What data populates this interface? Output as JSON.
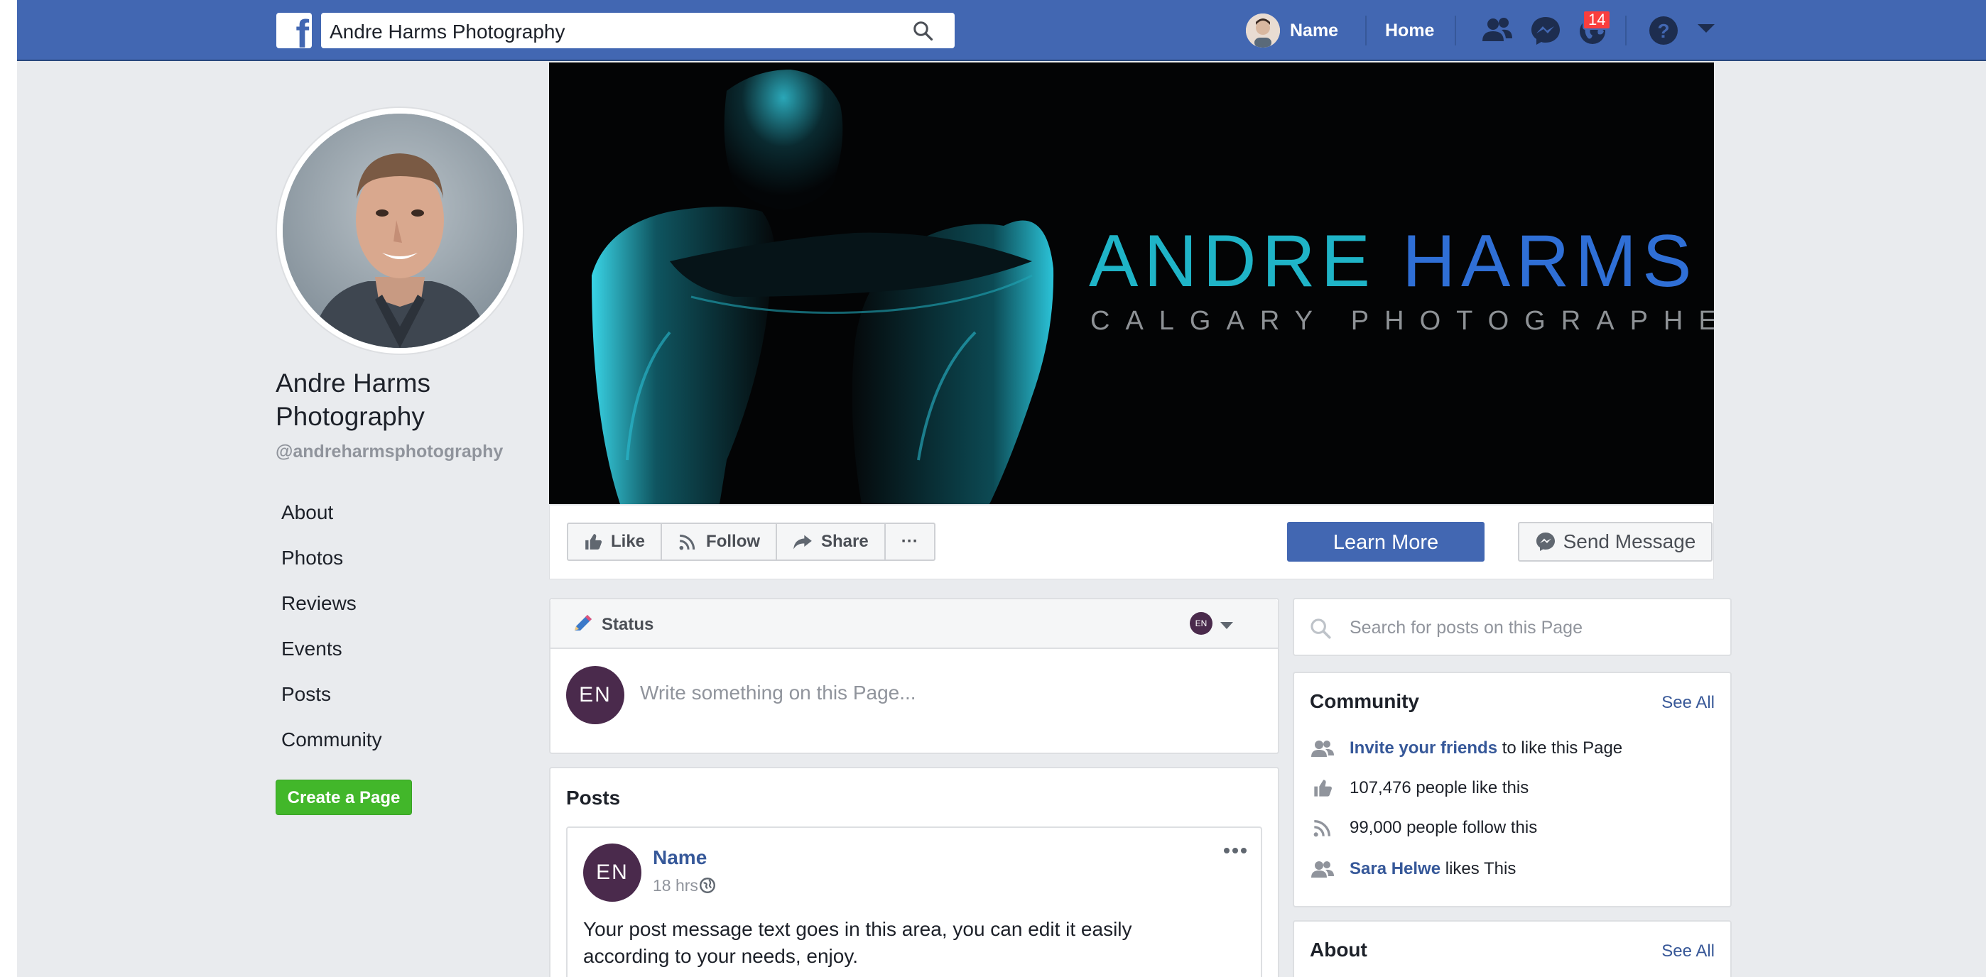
{
  "topbar": {
    "logo_letter": "f",
    "search_value": "Andre Harms Photography",
    "user_name": "Name",
    "home_label": "Home",
    "notifications_count": "14",
    "brand_color": "#4267b2"
  },
  "profile": {
    "page_name": "Andre Harms Photography",
    "handle": "@andreharmsphotography"
  },
  "left_nav": {
    "items": [
      {
        "label": "About"
      },
      {
        "label": "Photos"
      },
      {
        "label": "Reviews"
      },
      {
        "label": "Events"
      },
      {
        "label": "Posts"
      },
      {
        "label": "Community"
      }
    ],
    "create_page_label": "Create a Page",
    "create_page_color": "#42b72a"
  },
  "cover": {
    "title_part1": "ANDRE ",
    "title_part2": "HARMS",
    "subtitle": "CALGARY PHOTOGRAPHER"
  },
  "actions": {
    "like_label": "Like",
    "follow_label": "Follow",
    "share_label": "Share",
    "more_label": "···",
    "learn_more_label": "Learn More",
    "send_message_label": "Send Message"
  },
  "composer": {
    "header_label": "Status",
    "mini_avatar_initials": "EN",
    "avatar_initials": "EN",
    "placeholder": "Write something on this Page..."
  },
  "posts": {
    "section_title": "Posts",
    "post": {
      "avatar_initials": "EN",
      "author": "Name",
      "time": "18 hrs",
      "text": "Your post message text goes in this area, you can edit it easily according to your needs, enjoy."
    }
  },
  "sidebar_right": {
    "search_placeholder": "Search for posts on this Page",
    "community": {
      "title": "Community",
      "see_all": "See All",
      "invite_link": "Invite your friends",
      "invite_rest": " to like this Page",
      "likes_text": "107,476 people like this",
      "follows_text": "99,000 people follow this",
      "friend_link": "Sara Helwe",
      "friend_rest": " likes This"
    },
    "about": {
      "title": "About",
      "see_all": "See All"
    }
  }
}
